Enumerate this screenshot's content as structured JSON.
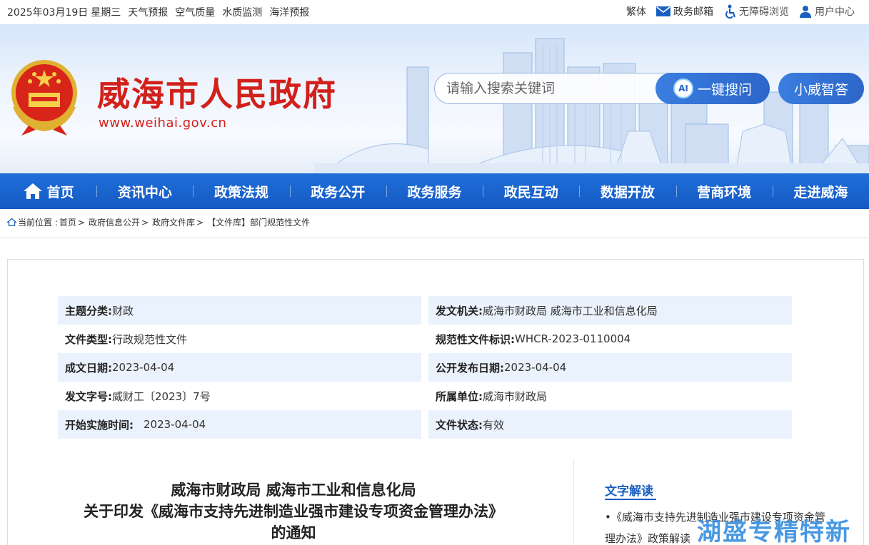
{
  "topbar": {
    "date": "2025年03月19日",
    "weekday": "星期三",
    "links": [
      "天气预报",
      "空气质量",
      "水质监测",
      "海洋预报"
    ],
    "traditional": "繁体",
    "mailbox": "政务邮箱",
    "accessibility": "无障碍浏览",
    "user_center": "用户中心"
  },
  "header": {
    "title": "威海市人民政府",
    "url": "www.weihai.gov.cn",
    "search_placeholder": "请输入搜索关键词",
    "search_ai_label": "AI",
    "search_button": "一键搜问",
    "assistant_button": "小威智答"
  },
  "nav": {
    "items": [
      "首页",
      "资讯中心",
      "政策法规",
      "政务公开",
      "政务服务",
      "政民互动",
      "数据开放",
      "营商环境",
      "走进威海"
    ]
  },
  "breadcrumb": {
    "label": "当前位置 :",
    "items": [
      "首页",
      "政府信息公开",
      "政府文件库",
      "【文件库】部门规范性文件"
    ],
    "separator": ">"
  },
  "meta": {
    "rows": [
      [
        {
          "k": "主题分类:",
          "v": "财政"
        },
        {
          "k": "发文机关:",
          "v": "威海市财政局 威海市工业和信息化局"
        }
      ],
      [
        {
          "k": "文件类型:",
          "v": "行政规范性文件"
        },
        {
          "k": "规范性文件标识:",
          "v": "WHCR-2023-0110004"
        }
      ],
      [
        {
          "k": "成文日期:",
          "v": "2023-04-04"
        },
        {
          "k": "公开发布日期:",
          "v": "2023-04-04"
        }
      ],
      [
        {
          "k": "发文字号:",
          "v": "威财工〔2023〕7号"
        },
        {
          "k": "所属单位:",
          "v": "威海市财政局"
        }
      ],
      [
        {
          "k": "开始实施时间:",
          "v": "2023-04-04"
        },
        {
          "k": "文件状态:",
          "v": "有效"
        }
      ]
    ]
  },
  "document": {
    "title_line1": "威海市财政局 威海市工业和信息化局",
    "title_line2": "关于印发《威海市支持先进制造业强市建设专项资金管理办法》",
    "title_line3": "的通知"
  },
  "interpretation": {
    "heading": "文字解读",
    "link": "•《威海市支持先进制造业强市建设专项资金管理办法》政策解读"
  },
  "watermark": "湖盛专精特新",
  "colors": {
    "brand_red": "#d2201a",
    "nav_blue": "#1559c4",
    "meta_bg": "#eaf2fd",
    "link_blue": "#1a5fbf"
  }
}
